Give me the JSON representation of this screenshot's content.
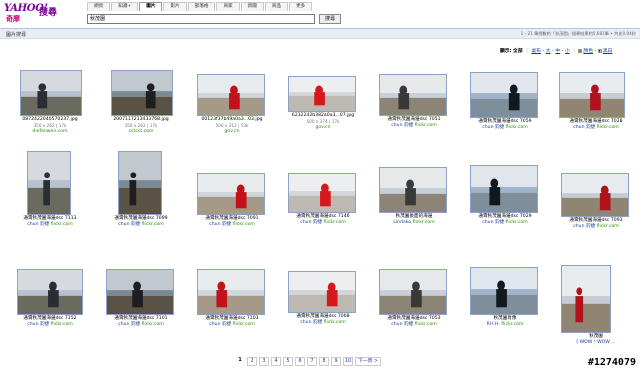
{
  "header": {
    "logo_text": "YAHOO!",
    "logo_sub": "奇摩",
    "logo_search": "搜尋",
    "tabs": [
      "網頁",
      "知識+",
      "圖片",
      "影片",
      "部落格",
      "商家",
      "新聞",
      "商品",
      "更多"
    ],
    "active_tab": 2,
    "search_value": "秋茂園",
    "search_button": "搜尋"
  },
  "bar": {
    "title": "圖片搜尋",
    "summary": "1 - 21 筆總數約「秋茂園」搜尋結果約5,681筆 • 共花0.04秒"
  },
  "options": {
    "size_label": "顯示:",
    "size_all": "全部",
    "sizes": [
      "桌布",
      "大",
      "中",
      "小"
    ],
    "color_label": "顏色",
    "bw_label": "黑白"
  },
  "colors": {
    "accent": "#7b0099",
    "link": "#1a3a9a",
    "source": "#2a8a00"
  },
  "results": [
    {
      "caption": "0872422040570237.jpg",
      "meta": "350 x 262 | 17k",
      "source": "diefanwen.com"
    },
    {
      "caption": "2007117213433768.jpg",
      "meta": "350 x 262 | 17k",
      "source": "cctcct.com"
    },
    {
      "caption": "00123f37b49a0a3...03.jpg",
      "meta": "500 x 312 | 53k",
      "source": "gov.cn"
    },
    {
      "caption": "6232242b382a0a3...07.jpg",
      "meta": "500 x 374 | 17k",
      "source": "gov.cn"
    },
    {
      "caption": "通霄秋茂園海邊dsc 7051",
      "user": "chun",
      "user_alias": "鈞捷",
      "source": "flickr.com"
    },
    {
      "caption": "通霄秋茂園海邊dsc 7059",
      "user": "chun",
      "user_alias": "鈞捷",
      "source": "flickr.com"
    },
    {
      "caption": "通霄秋茂園海邊dsc 7028",
      "user": "chun",
      "user_alias": "鈞捷",
      "source": "flickr.com"
    },
    {
      "caption": "通霄秋茂園海邊dsc 7113",
      "user": "chun",
      "user_alias": "鈞捷",
      "source": "flickr.com"
    },
    {
      "caption": "通霄秋茂園海邊dsc 7099",
      "user": "chun",
      "user_alias": "鈞捷",
      "source": "flickr.com"
    },
    {
      "caption": "通霄秋茂園海邊dsc 7091",
      "user": "chun",
      "user_alias": "鈞捷",
      "source": "flickr.com"
    },
    {
      "caption": "通霄秋茂園海邊dsc 7146",
      "user": "chun",
      "user_alias": "鈞捷",
      "source": "flickr.com"
    },
    {
      "caption": "秋茂園後面的海邊",
      "user": "Lindako",
      "user_alias": "",
      "source": "flickr.com"
    },
    {
      "caption": "通霄秋茂園海邊dsc 7029",
      "user": "chun",
      "user_alias": "鈞捷",
      "source": "flickr.com"
    },
    {
      "caption": "通霄秋茂園海邊dsc 7093",
      "user": "chun",
      "user_alias": "鈞捷",
      "source": "flickr.com"
    },
    {
      "caption": "通霄秋茂園海邊dsc 7152",
      "user": "chun",
      "user_alias": "鈞捷",
      "source": "flickr.com"
    },
    {
      "caption": "通霄秋茂園海邊dsc 7101",
      "user": "chun",
      "user_alias": "鈞捷",
      "source": "flickr.com"
    },
    {
      "caption": "通霄秋茂園海邊dsc 7103",
      "user": "chun",
      "user_alias": "鈞捷",
      "source": "flickr.com"
    },
    {
      "caption": "通霄秋茂園海邊dsc 7068",
      "user": "chun",
      "user_alias": "鈞捷",
      "source": "flickr.com"
    },
    {
      "caption": "通霄秋茂園海邊dsc 7053",
      "user": "chun",
      "user_alias": "鈞捷",
      "source": "flickr.com"
    },
    {
      "caption": "秋茂園肖像",
      "user": "P.H.H.",
      "user_alias": "",
      "source": "flickr.com"
    },
    {
      "caption": "秋茂園",
      "user": "[ WOW ! WOW ...",
      "user_alias": "",
      "source": ""
    }
  ],
  "pager": {
    "pages": [
      "1",
      "2",
      "3",
      "4",
      "5",
      "6",
      "7",
      "8",
      "9",
      "10"
    ],
    "current": "1",
    "next": "下一頁 >"
  },
  "watermark": "#1274079"
}
